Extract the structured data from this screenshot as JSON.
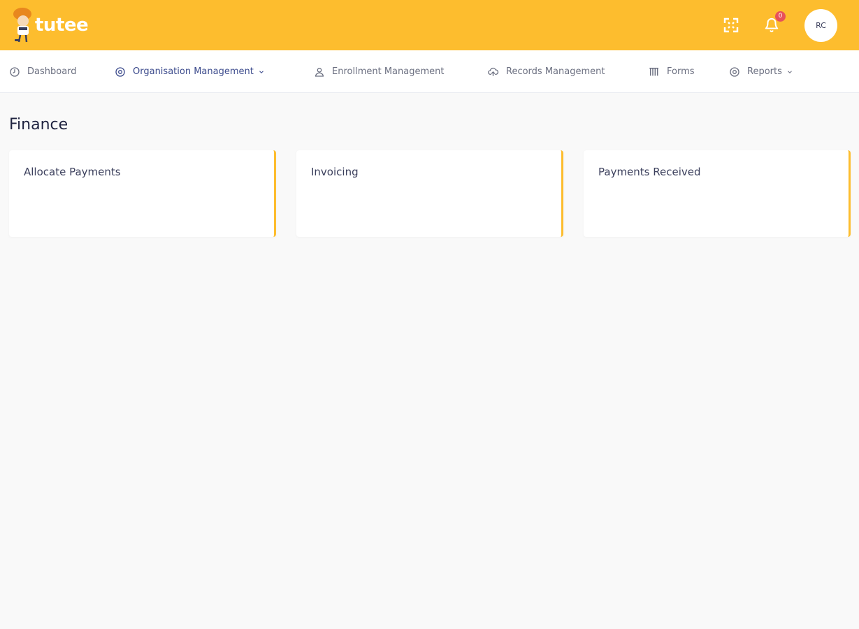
{
  "brand": {
    "name": "tutee",
    "logo_icon": "mascot-icon",
    "primary_color": "#fdbd2e"
  },
  "header": {
    "fullscreen_icon": "expand-icon",
    "notifications_icon": "bell-icon",
    "notification_count": "0",
    "avatar_initials": "RC"
  },
  "nav": {
    "items": [
      {
        "label": "Dashboard",
        "icon": "clock-icon"
      },
      {
        "label": "Organisation Management",
        "icon": "target-icon",
        "has_dropdown": true,
        "active": true
      },
      {
        "label": "Enrollment Management",
        "icon": "user-icon"
      },
      {
        "label": "Records Management",
        "icon": "cloud-upload-icon"
      },
      {
        "label": "Forms",
        "icon": "columns-icon"
      },
      {
        "label": "Reports",
        "icon": "target-icon",
        "has_dropdown": true
      }
    ]
  },
  "main": {
    "title": "Finance",
    "cards": [
      {
        "title": "Allocate Payments"
      },
      {
        "title": "Invoicing"
      },
      {
        "title": "Payments Received"
      }
    ]
  }
}
